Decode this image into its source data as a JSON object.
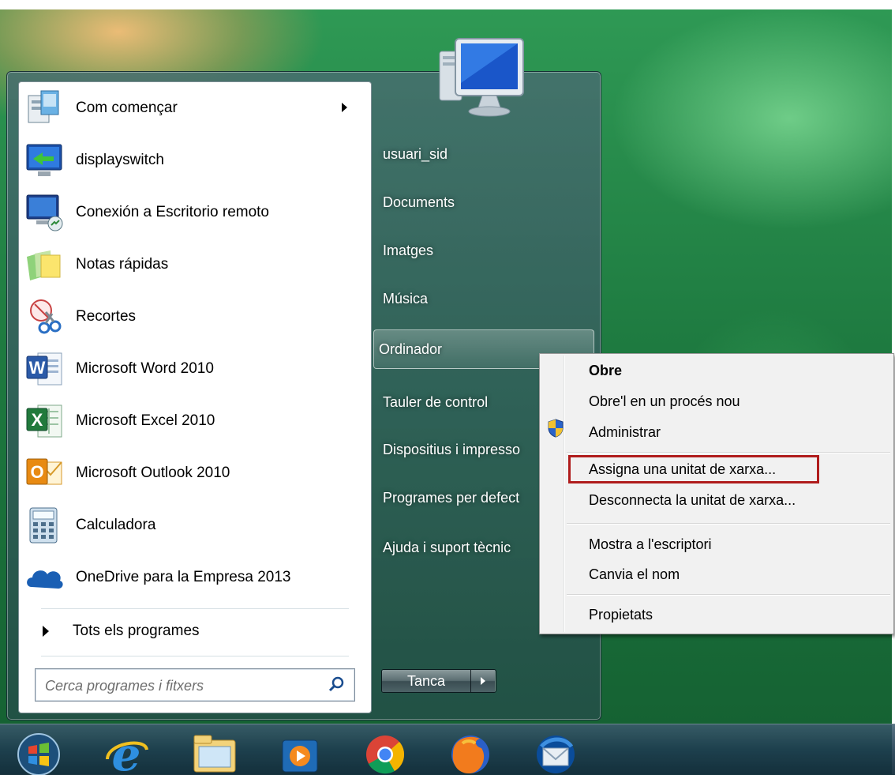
{
  "start_menu": {
    "programs": [
      {
        "label": "Com començar",
        "icon": "getting-started-icon",
        "has_submenu": true
      },
      {
        "label": "displayswitch",
        "icon": "displayswitch-icon",
        "has_submenu": false
      },
      {
        "label": "Conexión a Escritorio remoto",
        "icon": "remote-desktop-icon",
        "has_submenu": false
      },
      {
        "label": "Notas rápidas",
        "icon": "sticky-notes-icon",
        "has_submenu": false
      },
      {
        "label": "Recortes",
        "icon": "snipping-tool-icon",
        "has_submenu": false
      },
      {
        "label": "Microsoft Word 2010",
        "icon": "word-icon",
        "has_submenu": false
      },
      {
        "label": "Microsoft Excel 2010",
        "icon": "excel-icon",
        "has_submenu": false
      },
      {
        "label": "Microsoft Outlook 2010",
        "icon": "outlook-icon",
        "has_submenu": false
      },
      {
        "label": "Calculadora",
        "icon": "calculator-icon",
        "has_submenu": false
      },
      {
        "label": "OneDrive para la Empresa 2013",
        "icon": "onedrive-icon",
        "has_submenu": false
      }
    ],
    "all_programs_label": "Tots els programes",
    "search": {
      "placeholder": "Cerca programes i fitxers",
      "value": ""
    },
    "right_items": [
      {
        "label": "usuari_sid"
      },
      {
        "label": "Documents"
      },
      {
        "label": "Imatges"
      },
      {
        "label": "Música"
      },
      {
        "label": "Ordinador"
      },
      {
        "label": "Tauler de control"
      },
      {
        "label": "Dispositius i impresso"
      },
      {
        "label": "Programes per defect"
      },
      {
        "label": "Ajuda i suport tècnic"
      }
    ],
    "shutdown_label": "Tanca"
  },
  "context_menu": {
    "items": [
      {
        "label": "Obre",
        "bold": true
      },
      {
        "label": "Obre'l en un procés nou",
        "bold": false
      },
      {
        "label": "Administrar",
        "bold": false,
        "icon": "uac-shield-icon"
      },
      {
        "label": "Assigna una unitat de xarxa...",
        "bold": false,
        "highlighted": true
      },
      {
        "label": "Desconnecta la unitat de xarxa...",
        "bold": false
      },
      {
        "label": "Mostra a l'escriptori",
        "bold": false
      },
      {
        "label": "Canvia el nom",
        "bold": false
      },
      {
        "label": "Propietats",
        "bold": false
      }
    ],
    "highlight_color": "#b01c1c"
  },
  "taskbar": {
    "items": [
      "start-orb-icon",
      "internet-explorer-icon",
      "file-explorer-icon",
      "media-player-icon",
      "chrome-icon",
      "firefox-icon",
      "thunderbird-icon"
    ]
  }
}
